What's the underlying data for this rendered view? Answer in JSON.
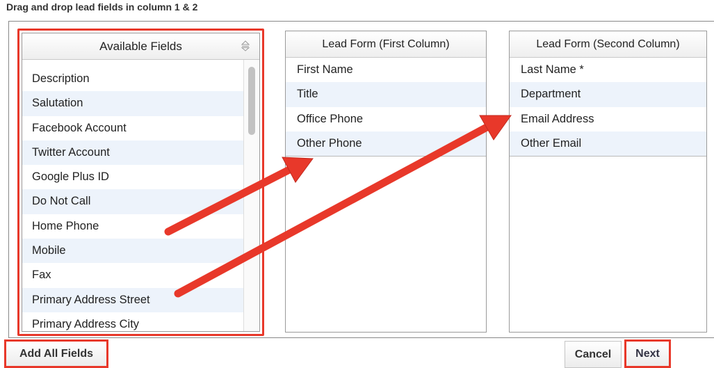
{
  "instruction": "Drag and drop lead fields in column 1 & 2",
  "available": {
    "title": "Available Fields",
    "items": [
      "Description",
      "Salutation",
      "Facebook Account",
      "Twitter Account",
      "Google Plus ID",
      "Do Not Call",
      "Home Phone",
      "Mobile",
      "Fax",
      "Primary Address Street",
      "Primary Address City"
    ]
  },
  "column1": {
    "title": "Lead Form (First Column)",
    "items": [
      "First Name",
      "Title",
      "Office Phone",
      "Other Phone"
    ]
  },
  "column2": {
    "title": "Lead Form (Second Column)",
    "items": [
      "Last Name *",
      "Department",
      "Email Address",
      "Other Email"
    ]
  },
  "buttons": {
    "add_all": "Add All Fields",
    "cancel": "Cancel",
    "next": "Next"
  },
  "colors": {
    "highlight": "#e8382a",
    "row_alt": "#edf3fb"
  }
}
